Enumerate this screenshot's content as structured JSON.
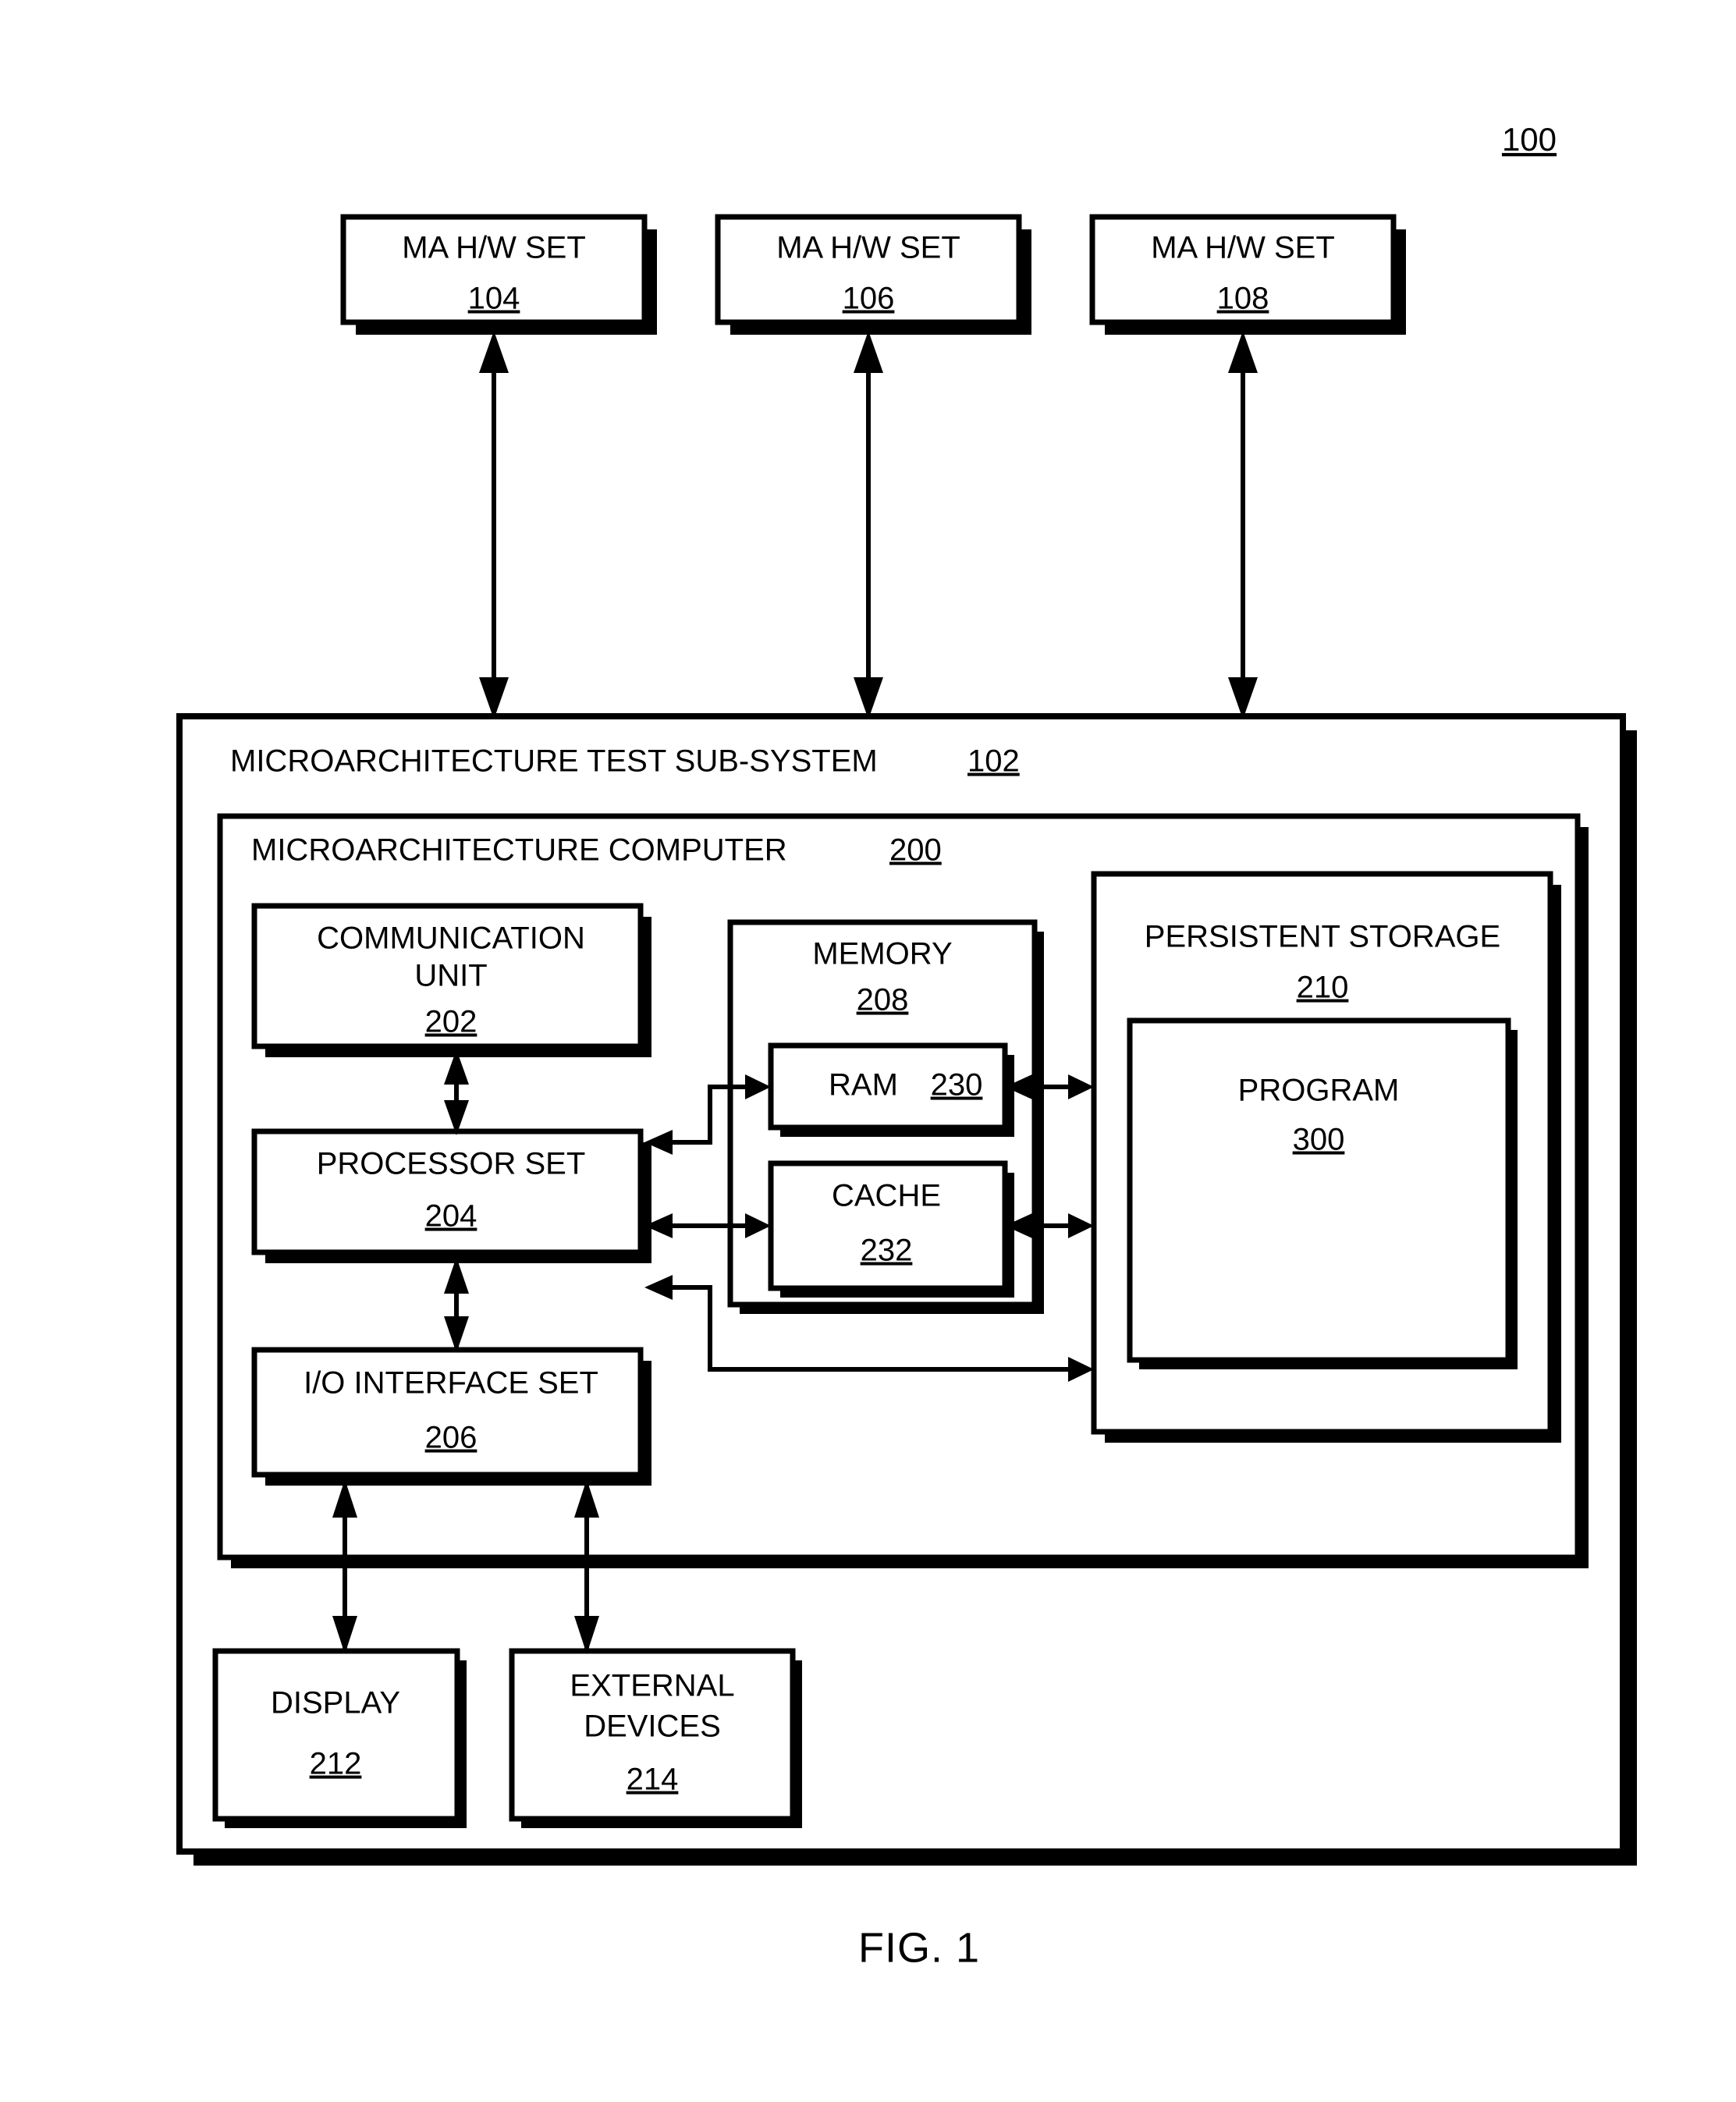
{
  "figure": {
    "reference_numeral": "100",
    "caption": "FIG. 1"
  },
  "top_blocks": [
    {
      "label": "MA H/W SET",
      "number": "104"
    },
    {
      "label": "MA H/W SET",
      "number": "106"
    },
    {
      "label": "MA H/W SET",
      "number": "108"
    }
  ],
  "subsystem": {
    "title": "MICROARCHITECTURE TEST SUB-SYSTEM",
    "number": "102"
  },
  "computer": {
    "title": "MICROARCHITECTURE COMPUTER",
    "number": "200"
  },
  "components": {
    "communication_unit": {
      "line1": "COMMUNICATION",
      "line2": "UNIT",
      "number": "202"
    },
    "processor_set": {
      "line1": "PROCESSOR SET",
      "number": "204"
    },
    "io_interface_set": {
      "line1": "I/O INTERFACE SET",
      "number": "206"
    },
    "memory": {
      "line1": "MEMORY",
      "number": "208"
    },
    "ram": {
      "line1": "RAM",
      "number": "230"
    },
    "cache": {
      "line1": "CACHE",
      "number": "232"
    },
    "persistent_storage": {
      "line1": "PERSISTENT STORAGE",
      "number": "210"
    },
    "program": {
      "line1": "PROGRAM",
      "number": "300"
    },
    "display": {
      "line1": "DISPLAY",
      "number": "212"
    },
    "external_devices": {
      "line1": "EXTERNAL",
      "line2": "DEVICES",
      "number": "214"
    }
  },
  "colors": {
    "ink": "#000000",
    "paper": "#ffffff"
  }
}
